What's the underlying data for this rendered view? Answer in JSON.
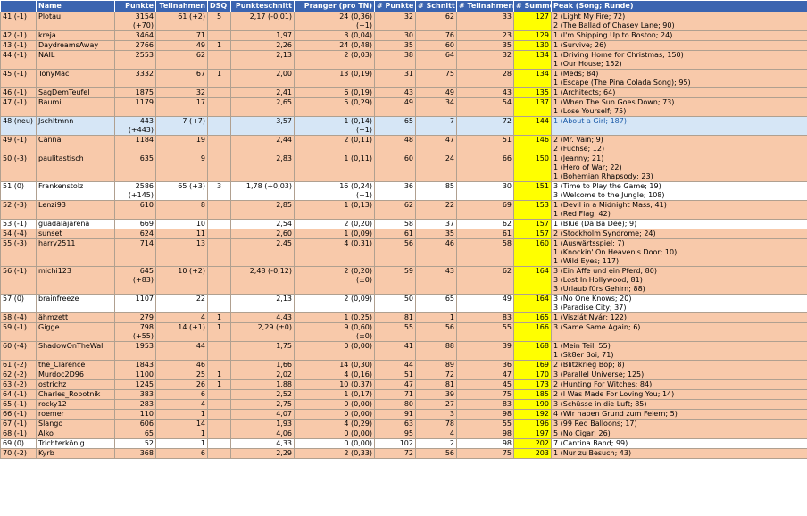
{
  "headers": [
    "",
    "Name",
    "Punkte",
    "Teilnahmen",
    "DSQ",
    "Punkteschnitt",
    "Pranger (pro TN)",
    "# Punkte",
    "# Schnitt",
    "# Teilnahmen",
    "# Summe",
    "Peak (Song; Runde)"
  ],
  "rows": [
    {
      "style": "peach",
      "rank": "41 (-1)",
      "name": "Plotau",
      "punkte": [
        "3154",
        "(+70)"
      ],
      "teil": "61 (+2)",
      "dsq": "5",
      "schnitt": "2,17 (-0,01)",
      "pranger": [
        "24 (0,36)",
        "(+1)"
      ],
      "p": "32",
      "s": "62",
      "t": "33",
      "sum": "127",
      "peak": [
        "2 (Light My Fire; 72)",
        "2 (The Ballad of Chasey Lane; 90)"
      ]
    },
    {
      "style": "peach",
      "rank": "42 (-1)",
      "name": "kreja",
      "punkte": [
        "3464"
      ],
      "teil": "71",
      "dsq": "",
      "schnitt": "1,97",
      "pranger": [
        "3 (0,04)"
      ],
      "p": "30",
      "s": "76",
      "t": "23",
      "sum": "129",
      "peak": [
        "1 (I'm Shipping Up to Boston; 24)"
      ]
    },
    {
      "style": "peach",
      "rank": "43 (-1)",
      "name": "DaydreamsAway",
      "punkte": [
        "2766"
      ],
      "teil": "49",
      "dsq": "1",
      "schnitt": "2,26",
      "pranger": [
        "24 (0,48)"
      ],
      "p": "35",
      "s": "60",
      "t": "35",
      "sum": "130",
      "peak": [
        "1 (Survive; 26)"
      ]
    },
    {
      "style": "peach",
      "rank": "44 (-1)",
      "name": "NAIL",
      "punkte": [
        "2553"
      ],
      "teil": "62",
      "dsq": "",
      "schnitt": "2,13",
      "pranger": [
        "2 (0,03)"
      ],
      "p": "38",
      "s": "64",
      "t": "32",
      "sum": "134",
      "peak": [
        "1 (Driving Home for Christmas; 150)",
        "1 (Our House; 152)"
      ]
    },
    {
      "style": "peach",
      "rank": "45 (-1)",
      "name": "TonyMac",
      "punkte": [
        "3332"
      ],
      "teil": "67",
      "dsq": "1",
      "schnitt": "2,00",
      "pranger": [
        "13 (0,19)"
      ],
      "p": "31",
      "s": "75",
      "t": "28",
      "sum": "134",
      "peak": [
        "1 (Meds; 84)",
        "1 (Escape (The Pina Colada Song); 95)"
      ]
    },
    {
      "style": "peach",
      "rank": "46 (-1)",
      "name": "SagDemTeufel",
      "punkte": [
        "1875"
      ],
      "teil": "32",
      "dsq": "",
      "schnitt": "2,41",
      "pranger": [
        "6 (0,19)"
      ],
      "p": "43",
      "s": "49",
      "t": "43",
      "sum": "135",
      "peak": [
        "1 (Architects; 64)"
      ]
    },
    {
      "style": "peach",
      "rank": "47 (-1)",
      "name": "Baumi",
      "punkte": [
        "1179"
      ],
      "teil": "17",
      "dsq": "",
      "schnitt": "2,65",
      "pranger": [
        "5 (0,29)"
      ],
      "p": "49",
      "s": "34",
      "t": "54",
      "sum": "137",
      "peak": [
        "1 (When The Sun Goes Down; 73)",
        "1 (Lose Yourself; 75)"
      ]
    },
    {
      "style": "blue",
      "rank": "48 (neu)",
      "name": "Jschltmnn",
      "punkte": [
        "443",
        "(+443)"
      ],
      "teil": "7 (+7)",
      "dsq": "",
      "schnitt": "3,57",
      "pranger": [
        "1 (0,14)",
        "(+1)"
      ],
      "p": "65",
      "s": "7",
      "t": "72",
      "sum": "144",
      "peak": [
        "1 (About a Girl; 187)"
      ]
    },
    {
      "style": "peach",
      "rank": "49 (-1)",
      "name": "Canna",
      "punkte": [
        "1184"
      ],
      "teil": "19",
      "dsq": "",
      "schnitt": "2,44",
      "pranger": [
        "2 (0,11)"
      ],
      "p": "48",
      "s": "47",
      "t": "51",
      "sum": "146",
      "peak": [
        "2 (Mr. Vain; 9)",
        "2 (Füchse; 12)"
      ]
    },
    {
      "style": "peach",
      "rank": "50 (-3)",
      "name": "paulitastisch",
      "punkte": [
        "635"
      ],
      "teil": "9",
      "dsq": "",
      "schnitt": "2,83",
      "pranger": [
        "1 (0,11)"
      ],
      "p": "60",
      "s": "24",
      "t": "66",
      "sum": "150",
      "peak": [
        "1 (Jeanny; 21)",
        "1 (Hero of War; 22)",
        "1 (Bohemian Rhapsody; 23)"
      ]
    },
    {
      "style": "white",
      "rank": "51 (0)",
      "name": "Frankenstolz",
      "punkte": [
        "2586",
        "(+145)"
      ],
      "teil": "65 (+3)",
      "dsq": "3",
      "schnitt": "1,78 (+0,03)",
      "pranger": [
        "16 (0,24)",
        "(+1)"
      ],
      "p": "36",
      "s": "85",
      "t": "30",
      "sum": "151",
      "peak": [
        "3 (Time to Play the Game; 19)",
        "3 (Welcome to the Jungle; 108)"
      ]
    },
    {
      "style": "peach",
      "rank": "52 (-3)",
      "name": "Lenzi93",
      "punkte": [
        "610"
      ],
      "teil": "8",
      "dsq": "",
      "schnitt": "2,85",
      "pranger": [
        "1 (0,13)"
      ],
      "p": "62",
      "s": "22",
      "t": "69",
      "sum": "153",
      "peak": [
        "1 (Devil in a Midnight Mass; 41)",
        "1 (Red Flag; 42)"
      ]
    },
    {
      "style": "white",
      "rank": "53 (-1)",
      "name": "guadalajarena",
      "punkte": [
        "669"
      ],
      "teil": "10",
      "dsq": "",
      "schnitt": "2,54",
      "pranger": [
        "2 (0,20)"
      ],
      "p": "58",
      "s": "37",
      "t": "62",
      "sum": "157",
      "peak": [
        "1 (Blue (Da Ba Dee); 9)"
      ]
    },
    {
      "style": "peach",
      "rank": "54 (-4)",
      "name": "sunset",
      "punkte": [
        "624"
      ],
      "teil": "11",
      "dsq": "",
      "schnitt": "2,60",
      "pranger": [
        "1 (0,09)"
      ],
      "p": "61",
      "s": "35",
      "t": "61",
      "sum": "157",
      "peak": [
        "2 (Stockholm Syndrome; 24)"
      ]
    },
    {
      "style": "peach",
      "rank": "55 (-3)",
      "name": "harry2511",
      "punkte": [
        "714"
      ],
      "teil": "13",
      "dsq": "",
      "schnitt": "2,45",
      "pranger": [
        "4 (0,31)"
      ],
      "p": "56",
      "s": "46",
      "t": "58",
      "sum": "160",
      "peak": [
        "1 (Auswärtsspiel; 7)",
        "1 (Knockin' On Heaven's Door; 10)",
        "1 (Wild Eyes; 117)"
      ]
    },
    {
      "style": "peach",
      "rank": "56 (-1)",
      "name": "michi123",
      "punkte": [
        "645",
        "(+83)"
      ],
      "teil": "10 (+2)",
      "dsq": "",
      "schnitt": "2,48 (-0,12)",
      "pranger": [
        "2 (0,20)",
        "(±0)"
      ],
      "p": "59",
      "s": "43",
      "t": "62",
      "sum": "164",
      "peak": [
        "3 (Ein Affe und ein Pferd; 80)",
        "3 (Lost In Hollywood; 81)",
        "3 (Urlaub fürs Gehirn; 88)"
      ]
    },
    {
      "style": "white",
      "rank": "57 (0)",
      "name": "brainfreeze",
      "punkte": [
        "1107"
      ],
      "teil": "22",
      "dsq": "",
      "schnitt": "2,13",
      "pranger": [
        "2 (0,09)"
      ],
      "p": "50",
      "s": "65",
      "t": "49",
      "sum": "164",
      "peak": [
        "3 (No One Knows; 20)",
        "3 (Paradise City; 37)"
      ]
    },
    {
      "style": "peach",
      "rank": "58 (-4)",
      "name": "ähmzett",
      "punkte": [
        "279"
      ],
      "teil": "4",
      "dsq": "1",
      "schnitt": "4,43",
      "pranger": [
        "1 (0,25)"
      ],
      "p": "81",
      "s": "1",
      "t": "83",
      "sum": "165",
      "peak": [
        "1 (Viszlát Nyár; 122)"
      ]
    },
    {
      "style": "peach",
      "rank": "59 (-1)",
      "name": "Gigge",
      "punkte": [
        "798",
        "(+55)"
      ],
      "teil": "14 (+1)",
      "dsq": "1",
      "schnitt": "2,29 (±0)",
      "pranger": [
        "9 (0,60)",
        "(±0)"
      ],
      "p": "55",
      "s": "56",
      "t": "55",
      "sum": "166",
      "peak": [
        "3 (Same Same Again; 6)"
      ]
    },
    {
      "style": "peach",
      "rank": "60 (-4)",
      "name": "ShadowOnTheWall",
      "punkte": [
        "1953"
      ],
      "teil": "44",
      "dsq": "",
      "schnitt": "1,75",
      "pranger": [
        "0 (0,00)"
      ],
      "p": "41",
      "s": "88",
      "t": "39",
      "sum": "168",
      "peak": [
        "1 (Mein Teil; 55)",
        "1 (Sk8er Boi; 71)"
      ]
    },
    {
      "style": "peach",
      "rank": "61 (-2)",
      "name": "the_Clarence",
      "punkte": [
        "1843"
      ],
      "teil": "46",
      "dsq": "",
      "schnitt": "1,66",
      "pranger": [
        "14 (0,30)"
      ],
      "p": "44",
      "s": "89",
      "t": "36",
      "sum": "169",
      "peak": [
        "2 (Blitzkrieg Bop; 8)"
      ]
    },
    {
      "style": "peach",
      "rank": "62 (-2)",
      "name": "Murdoc2D96",
      "punkte": [
        "1100"
      ],
      "teil": "25",
      "dsq": "1",
      "schnitt": "2,02",
      "pranger": [
        "4 (0,16)"
      ],
      "p": "51",
      "s": "72",
      "t": "47",
      "sum": "170",
      "peak": [
        "3 (Parallel Universe; 125)"
      ]
    },
    {
      "style": "peach",
      "rank": "63 (-2)",
      "name": "ostrichz",
      "punkte": [
        "1245"
      ],
      "teil": "26",
      "dsq": "1",
      "schnitt": "1,88",
      "pranger": [
        "10 (0,37)"
      ],
      "p": "47",
      "s": "81",
      "t": "45",
      "sum": "173",
      "peak": [
        "2 (Hunting For Witches; 84)"
      ]
    },
    {
      "style": "peach",
      "rank": "64 (-1)",
      "name": "Charles_Robotnik",
      "punkte": [
        "383"
      ],
      "teil": "6",
      "dsq": "",
      "schnitt": "2,52",
      "pranger": [
        "1 (0,17)"
      ],
      "p": "71",
      "s": "39",
      "t": "75",
      "sum": "185",
      "peak": [
        "2 (I Was Made For Loving You; 14)"
      ]
    },
    {
      "style": "peach",
      "rank": "65 (-1)",
      "name": "rocky12",
      "punkte": [
        "283"
      ],
      "teil": "4",
      "dsq": "",
      "schnitt": "2,75",
      "pranger": [
        "0 (0,00)"
      ],
      "p": "80",
      "s": "27",
      "t": "83",
      "sum": "190",
      "peak": [
        "3 (Schüsse in die Luft; 85)"
      ]
    },
    {
      "style": "peach",
      "rank": "66 (-1)",
      "name": "roemer",
      "punkte": [
        "110"
      ],
      "teil": "1",
      "dsq": "",
      "schnitt": "4,07",
      "pranger": [
        "0 (0,00)"
      ],
      "p": "91",
      "s": "3",
      "t": "98",
      "sum": "192",
      "peak": [
        "4 (Wir haben Grund zum Feiern; 5)"
      ]
    },
    {
      "style": "peach",
      "rank": "67 (-1)",
      "name": "Slango",
      "punkte": [
        "606"
      ],
      "teil": "14",
      "dsq": "",
      "schnitt": "1,93",
      "pranger": [
        "4 (0,29)"
      ],
      "p": "63",
      "s": "78",
      "t": "55",
      "sum": "196",
      "peak": [
        "3 (99 Red Balloons; 17)"
      ]
    },
    {
      "style": "peach",
      "rank": "68 (-1)",
      "name": "Alko",
      "punkte": [
        "65"
      ],
      "teil": "1",
      "dsq": "",
      "schnitt": "4,06",
      "pranger": [
        "0 (0,00)"
      ],
      "p": "95",
      "s": "4",
      "t": "98",
      "sum": "197",
      "peak": [
        "5 (No Cigar; 26)"
      ]
    },
    {
      "style": "white",
      "rank": "69 (0)",
      "name": "Trichterkönig",
      "punkte": [
        "52"
      ],
      "teil": "1",
      "dsq": "",
      "schnitt": "4,33",
      "pranger": [
        "0 (0,00)"
      ],
      "p": "102",
      "s": "2",
      "t": "98",
      "sum": "202",
      "peak": [
        "7 (Cantina Band; 99)"
      ]
    },
    {
      "style": "peach",
      "rank": "70 (-2)",
      "name": "Kyrb",
      "punkte": [
        "368"
      ],
      "teil": "6",
      "dsq": "",
      "schnitt": "2,29",
      "pranger": [
        "2 (0,33)"
      ],
      "p": "72",
      "s": "56",
      "t": "75",
      "sum": "203",
      "peak": [
        "1 (Nur zu Besuch; 43)"
      ]
    }
  ]
}
